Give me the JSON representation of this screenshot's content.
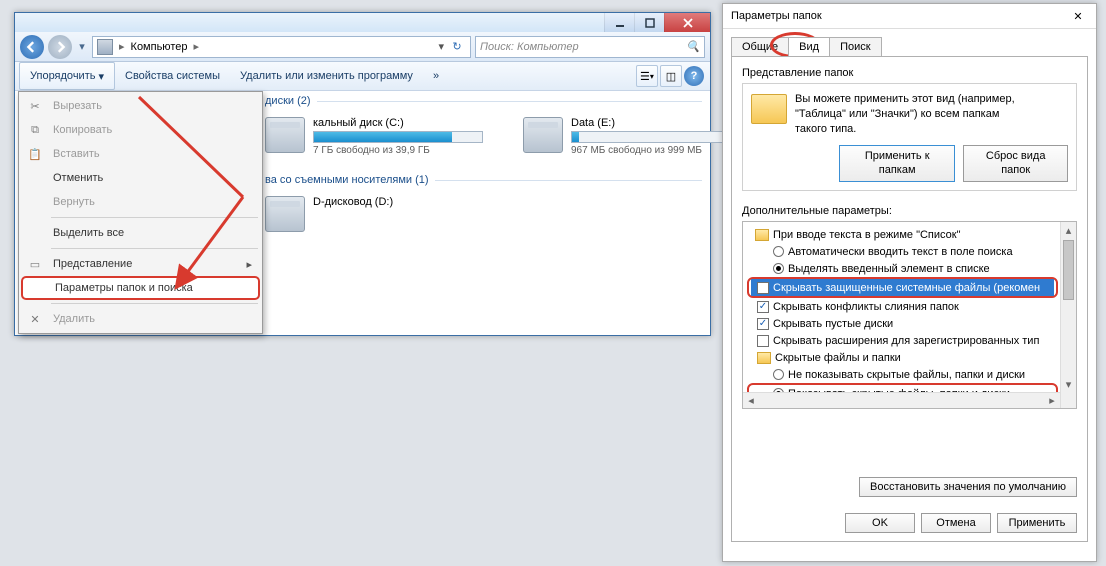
{
  "explorer": {
    "breadcrumb_item": "Компьютер",
    "search_placeholder": "Поиск: Компьютер",
    "toolbar": {
      "organize": "Упорядочить",
      "system_props": "Свойства системы",
      "uninstall": "Удалить или изменить программу",
      "more_chevron": "»"
    },
    "menu": {
      "cut": "Вырезать",
      "copy": "Копировать",
      "paste": "Вставить",
      "undo": "Отменить",
      "redo": "Вернуть",
      "select_all": "Выделить все",
      "layout": "Представление",
      "folder_options": "Параметры папок и поиска",
      "delete": "Удалить"
    },
    "sections": {
      "hdd_header": "диски (2)",
      "removable_header": "ва со съемными носителями (1)"
    },
    "drives": [
      {
        "name": "кальный диск (C:)",
        "free": "7 ГБ свободно из 39,9 ГБ",
        "fill_pct": 82
      },
      {
        "name": "Data (E:)",
        "free": "967 МБ свободно из 999 МБ",
        "fill_pct": 4
      }
    ],
    "dvd": "D-дисковод (D:)"
  },
  "dialog": {
    "title": "Параметры папок",
    "tabs": {
      "general": "Общие",
      "view": "Вид",
      "search": "Поиск"
    },
    "view_group": {
      "caption": "Представление папок",
      "text1": "Вы можете применить этот вид (например,",
      "text2": "\"Таблица\" или \"Значки\") ко всем папкам",
      "text3": "такого типа.",
      "apply_btn": "Применить к папкам",
      "reset_btn": "Сброс вида папок"
    },
    "advanced_label": "Дополнительные параметры:",
    "tree": {
      "n0": "При вводе текста в режиме \"Список\"",
      "n1": "Автоматически вводить текст в поле поиска",
      "n2": "Выделять введенный элемент в списке",
      "n3": "Скрывать защищенные системные файлы (рекомен",
      "n4": "Скрывать конфликты слияния папок",
      "n5": "Скрывать пустые диски",
      "n6": "Скрывать расширения для зарегистрированных тип",
      "n7": "Скрытые файлы и папки",
      "n8": "Не показывать скрытые файлы, папки и диски",
      "n9": "Показывать скрытые файлы, папки и диски"
    },
    "restore": "Восстановить значения по умолчанию",
    "footer": {
      "ok": "OK",
      "cancel": "Отмена",
      "apply": "Применить"
    }
  }
}
